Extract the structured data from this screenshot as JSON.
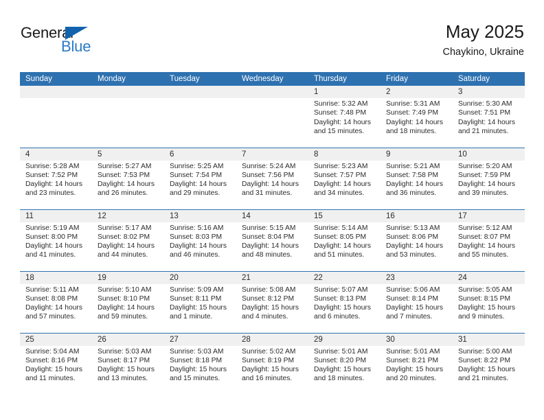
{
  "brand": {
    "word_one": "General",
    "word_two": "Blue",
    "triangle_icon": "triangle-icon"
  },
  "header": {
    "title": "May 2025",
    "location": "Chaykino, Ukraine"
  },
  "theme": {
    "header_blue": "#2e71b0",
    "band_gray": "#f0f0f0",
    "brand_blue": "#2a7ac4",
    "triangle_blue": "#1263ad",
    "text": "#2b2b2b"
  },
  "calendar": {
    "day_headers": [
      "Sunday",
      "Monday",
      "Tuesday",
      "Wednesday",
      "Thursday",
      "Friday",
      "Saturday"
    ],
    "weeks": [
      [
        {
          "day": "",
          "lines": []
        },
        {
          "day": "",
          "lines": []
        },
        {
          "day": "",
          "lines": []
        },
        {
          "day": "",
          "lines": []
        },
        {
          "day": "1",
          "lines": [
            "Sunrise: 5:32 AM",
            "Sunset: 7:48 PM",
            "Daylight: 14 hours",
            "and 15 minutes."
          ]
        },
        {
          "day": "2",
          "lines": [
            "Sunrise: 5:31 AM",
            "Sunset: 7:49 PM",
            "Daylight: 14 hours",
            "and 18 minutes."
          ]
        },
        {
          "day": "3",
          "lines": [
            "Sunrise: 5:30 AM",
            "Sunset: 7:51 PM",
            "Daylight: 14 hours",
            "and 21 minutes."
          ]
        }
      ],
      [
        {
          "day": "4",
          "lines": [
            "Sunrise: 5:28 AM",
            "Sunset: 7:52 PM",
            "Daylight: 14 hours",
            "and 23 minutes."
          ]
        },
        {
          "day": "5",
          "lines": [
            "Sunrise: 5:27 AM",
            "Sunset: 7:53 PM",
            "Daylight: 14 hours",
            "and 26 minutes."
          ]
        },
        {
          "day": "6",
          "lines": [
            "Sunrise: 5:25 AM",
            "Sunset: 7:54 PM",
            "Daylight: 14 hours",
            "and 29 minutes."
          ]
        },
        {
          "day": "7",
          "lines": [
            "Sunrise: 5:24 AM",
            "Sunset: 7:56 PM",
            "Daylight: 14 hours",
            "and 31 minutes."
          ]
        },
        {
          "day": "8",
          "lines": [
            "Sunrise: 5:23 AM",
            "Sunset: 7:57 PM",
            "Daylight: 14 hours",
            "and 34 minutes."
          ]
        },
        {
          "day": "9",
          "lines": [
            "Sunrise: 5:21 AM",
            "Sunset: 7:58 PM",
            "Daylight: 14 hours",
            "and 36 minutes."
          ]
        },
        {
          "day": "10",
          "lines": [
            "Sunrise: 5:20 AM",
            "Sunset: 7:59 PM",
            "Daylight: 14 hours",
            "and 39 minutes."
          ]
        }
      ],
      [
        {
          "day": "11",
          "lines": [
            "Sunrise: 5:19 AM",
            "Sunset: 8:00 PM",
            "Daylight: 14 hours",
            "and 41 minutes."
          ]
        },
        {
          "day": "12",
          "lines": [
            "Sunrise: 5:17 AM",
            "Sunset: 8:02 PM",
            "Daylight: 14 hours",
            "and 44 minutes."
          ]
        },
        {
          "day": "13",
          "lines": [
            "Sunrise: 5:16 AM",
            "Sunset: 8:03 PM",
            "Daylight: 14 hours",
            "and 46 minutes."
          ]
        },
        {
          "day": "14",
          "lines": [
            "Sunrise: 5:15 AM",
            "Sunset: 8:04 PM",
            "Daylight: 14 hours",
            "and 48 minutes."
          ]
        },
        {
          "day": "15",
          "lines": [
            "Sunrise: 5:14 AM",
            "Sunset: 8:05 PM",
            "Daylight: 14 hours",
            "and 51 minutes."
          ]
        },
        {
          "day": "16",
          "lines": [
            "Sunrise: 5:13 AM",
            "Sunset: 8:06 PM",
            "Daylight: 14 hours",
            "and 53 minutes."
          ]
        },
        {
          "day": "17",
          "lines": [
            "Sunrise: 5:12 AM",
            "Sunset: 8:07 PM",
            "Daylight: 14 hours",
            "and 55 minutes."
          ]
        }
      ],
      [
        {
          "day": "18",
          "lines": [
            "Sunrise: 5:11 AM",
            "Sunset: 8:08 PM",
            "Daylight: 14 hours",
            "and 57 minutes."
          ]
        },
        {
          "day": "19",
          "lines": [
            "Sunrise: 5:10 AM",
            "Sunset: 8:10 PM",
            "Daylight: 14 hours",
            "and 59 minutes."
          ]
        },
        {
          "day": "20",
          "lines": [
            "Sunrise: 5:09 AM",
            "Sunset: 8:11 PM",
            "Daylight: 15 hours",
            "and 1 minute."
          ]
        },
        {
          "day": "21",
          "lines": [
            "Sunrise: 5:08 AM",
            "Sunset: 8:12 PM",
            "Daylight: 15 hours",
            "and 4 minutes."
          ]
        },
        {
          "day": "22",
          "lines": [
            "Sunrise: 5:07 AM",
            "Sunset: 8:13 PM",
            "Daylight: 15 hours",
            "and 6 minutes."
          ]
        },
        {
          "day": "23",
          "lines": [
            "Sunrise: 5:06 AM",
            "Sunset: 8:14 PM",
            "Daylight: 15 hours",
            "and 7 minutes."
          ]
        },
        {
          "day": "24",
          "lines": [
            "Sunrise: 5:05 AM",
            "Sunset: 8:15 PM",
            "Daylight: 15 hours",
            "and 9 minutes."
          ]
        }
      ],
      [
        {
          "day": "25",
          "lines": [
            "Sunrise: 5:04 AM",
            "Sunset: 8:16 PM",
            "Daylight: 15 hours",
            "and 11 minutes."
          ]
        },
        {
          "day": "26",
          "lines": [
            "Sunrise: 5:03 AM",
            "Sunset: 8:17 PM",
            "Daylight: 15 hours",
            "and 13 minutes."
          ]
        },
        {
          "day": "27",
          "lines": [
            "Sunrise: 5:03 AM",
            "Sunset: 8:18 PM",
            "Daylight: 15 hours",
            "and 15 minutes."
          ]
        },
        {
          "day": "28",
          "lines": [
            "Sunrise: 5:02 AM",
            "Sunset: 8:19 PM",
            "Daylight: 15 hours",
            "and 16 minutes."
          ]
        },
        {
          "day": "29",
          "lines": [
            "Sunrise: 5:01 AM",
            "Sunset: 8:20 PM",
            "Daylight: 15 hours",
            "and 18 minutes."
          ]
        },
        {
          "day": "30",
          "lines": [
            "Sunrise: 5:01 AM",
            "Sunset: 8:21 PM",
            "Daylight: 15 hours",
            "and 20 minutes."
          ]
        },
        {
          "day": "31",
          "lines": [
            "Sunrise: 5:00 AM",
            "Sunset: 8:22 PM",
            "Daylight: 15 hours",
            "and 21 minutes."
          ]
        }
      ]
    ]
  }
}
